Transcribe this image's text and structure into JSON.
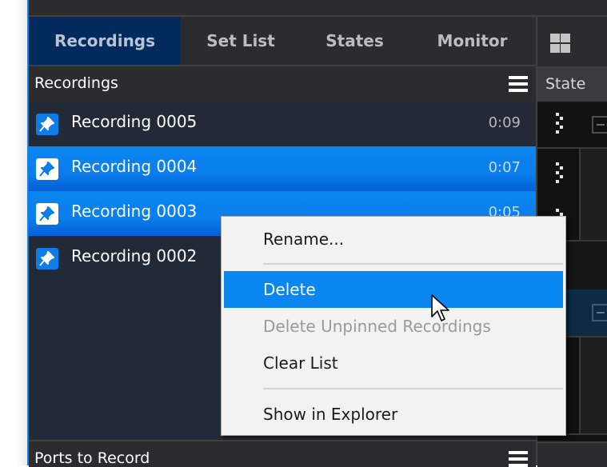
{
  "tabs": [
    {
      "label": "Recordings",
      "active": true
    },
    {
      "label": "Set List",
      "active": false
    },
    {
      "label": "States",
      "active": false
    },
    {
      "label": "Monitor",
      "active": false
    }
  ],
  "layout_icon": "grid-layout-icon",
  "recordings_panel": {
    "title": "Recordings",
    "menu_icon": "hamburger-menu-icon",
    "items": [
      {
        "name": "Recording 0005",
        "duration": "0:09",
        "pinned": true,
        "selected": false
      },
      {
        "name": "Recording 0004",
        "duration": "0:07",
        "pinned": true,
        "selected": true
      },
      {
        "name": "Recording 0003",
        "duration": "0:05",
        "pinned": true,
        "selected": true
      },
      {
        "name": "Recording 0002",
        "duration": "",
        "pinned": true,
        "selected": false
      }
    ]
  },
  "ports_panel": {
    "title": "Ports to Record",
    "menu_icon": "hamburger-menu-icon"
  },
  "state_panel": {
    "title": "State"
  },
  "context_menu": {
    "items": [
      {
        "label": "Rename...",
        "state": "normal"
      },
      {
        "label": "Delete",
        "state": "highlighted"
      },
      {
        "label": "Delete Unpinned Recordings",
        "state": "disabled"
      },
      {
        "label": "Clear List",
        "state": "normal"
      },
      {
        "label": "Show in Explorer",
        "state": "normal"
      }
    ]
  },
  "colors": {
    "accent": "#0a86f0",
    "active_tab": "#002b5c",
    "list_bg": "#222a37",
    "panel_bg": "#2c2c2e"
  }
}
